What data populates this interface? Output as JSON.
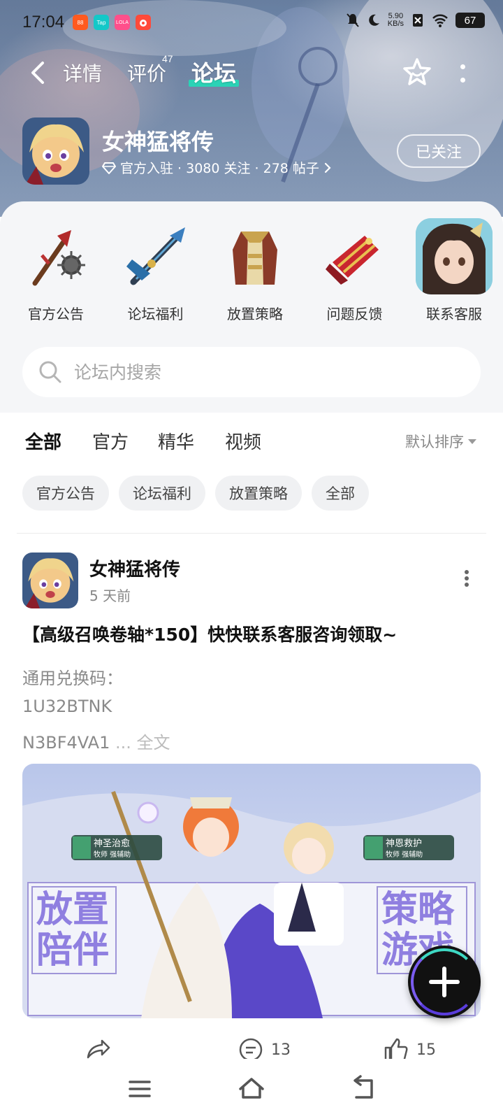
{
  "status": {
    "time": "17:04",
    "apps": [
      {
        "icon": "orange-app-icon",
        "color": "#ff5a1f",
        "text": "88"
      },
      {
        "icon": "taptap-icon",
        "color": "#14c8c8",
        "text": "Tap"
      },
      {
        "icon": "lofter-icon",
        "color": "#ff4f8b",
        "text": "LOLA"
      },
      {
        "icon": "red-app-icon",
        "color": "#ff4a3a",
        "text": ""
      }
    ],
    "net_speed_value": "5.90",
    "net_speed_unit": "KB/s",
    "battery": "67"
  },
  "nav": {
    "tabs": [
      {
        "label": "详情"
      },
      {
        "label": "评价"
      },
      {
        "label": "论坛"
      }
    ],
    "review_count": "47",
    "active_tab": "论坛",
    "accent": "#2ad3b6"
  },
  "game": {
    "name": "女神猛将传",
    "meta": "官方入驻 · 3080 关注 · 278 帖子",
    "follow_label": "已关注"
  },
  "quick_entries": [
    {
      "label": "官方公告",
      "icon": "spiked-mace-icon"
    },
    {
      "label": "论坛福利",
      "icon": "blue-sword-icon"
    },
    {
      "label": "放置策略",
      "icon": "robe-armor-icon"
    },
    {
      "label": "问题反馈",
      "icon": "gauntlet-icon"
    },
    {
      "label": "联系客服",
      "icon": "character-portrait-icon"
    }
  ],
  "search": {
    "placeholder": "论坛内搜索"
  },
  "feed": {
    "tabs": [
      "全部",
      "官方",
      "精华",
      "视频"
    ],
    "active_tab": "全部",
    "sort_label": "默认排序",
    "chips": [
      "官方公告",
      "论坛福利",
      "放置策略",
      "全部"
    ]
  },
  "post": {
    "author": "女神猛将传",
    "time": "5 天前",
    "title": "【高级召唤卷轴*150】快快联系客服咨询领取~",
    "lines": [
      "通用兑换码：",
      "1U32BTNK",
      "N3BF4VA1"
    ],
    "ellipsis": " ... ",
    "fulltext_label": "全文",
    "image": {
      "badge_left": "神圣治愈",
      "badge_left_sub": "牧师 强辅助",
      "badge_right": "神恩救护",
      "badge_right_sub": "牧师 强辅助",
      "text_left_top": "放置",
      "text_left_bottom": "陪伴",
      "text_right_top": "策略",
      "text_right_bottom": "游戏"
    },
    "actions": {
      "share_label": "",
      "comment_count": "13",
      "like_count": "15"
    }
  }
}
